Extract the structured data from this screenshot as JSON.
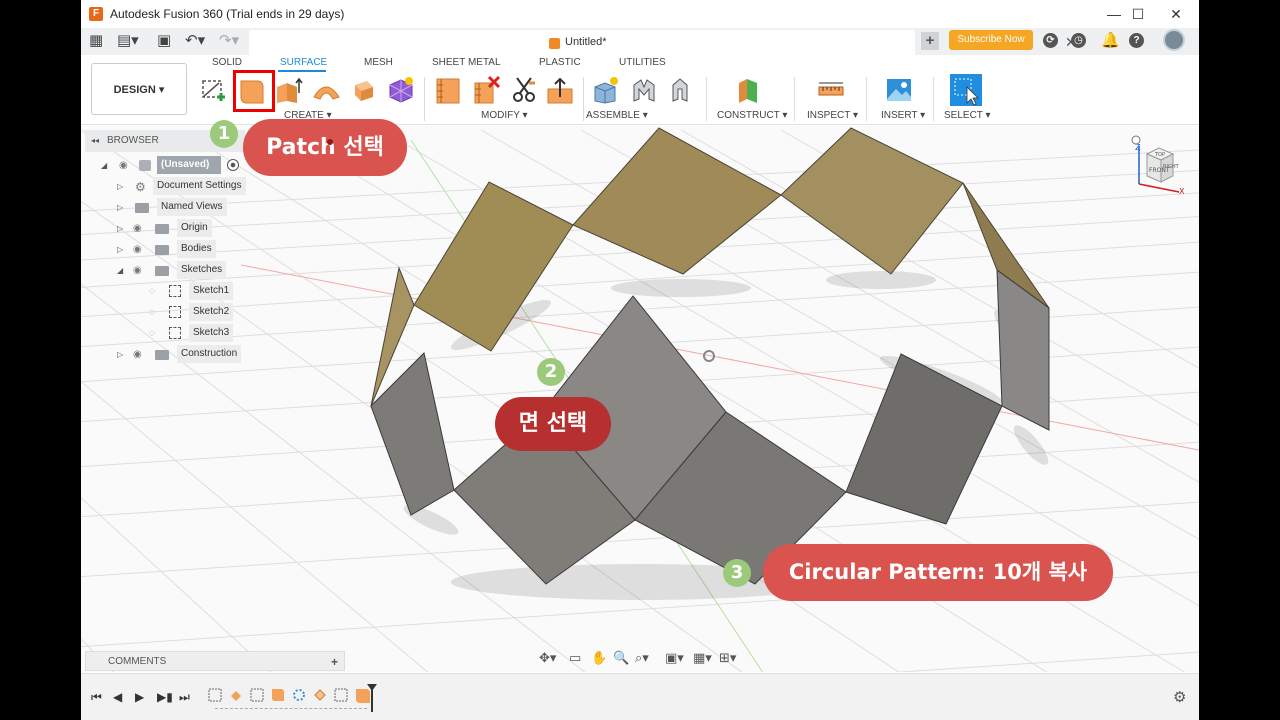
{
  "window": {
    "title": "Autodesk Fusion 360 (Trial ends in 29 days)",
    "logo_letter": "F",
    "minimize": "—",
    "maximize": "☐",
    "close": "✕"
  },
  "tabs": {
    "doc_title": "Untitled*",
    "close": "✕",
    "new": "+",
    "subscribe": "Subscribe Now"
  },
  "toolbar": {
    "workspace": "DESIGN ▾",
    "mode_tabs": [
      "SOLID",
      "SURFACE",
      "MESH",
      "SHEET METAL",
      "PLASTIC",
      "UTILITIES"
    ],
    "groups": {
      "create": "CREATE ▾",
      "modify": "MODIFY ▾",
      "assemble": "ASSEMBLE ▾",
      "construct": "CONSTRUCT ▾",
      "inspect": "INSPECT ▾",
      "insert": "INSERT ▾",
      "select": "SELECT ▾"
    }
  },
  "browser": {
    "header": "BROWSER",
    "root": "(Unsaved)",
    "items": [
      "Document Settings",
      "Named Views",
      "Origin",
      "Bodies",
      "Sketches",
      "Sketch1",
      "Sketch2",
      "Sketch3",
      "Construction"
    ]
  },
  "comments": {
    "label": "COMMENTS",
    "add": "+"
  },
  "viewcube": {
    "top": "TOP",
    "front": "FRONT",
    "right": "RIGHT",
    "z": "Z",
    "x": "X"
  },
  "callouts": [
    {
      "num": "1",
      "text": "Patch 선택"
    },
    {
      "num": "2",
      "text": "면 선택"
    },
    {
      "num": "3",
      "text": "Circular Pattern: 10개 복사"
    }
  ],
  "colors": {
    "accent": "#1d8ad9",
    "subscribe": "#f5a623",
    "callout_red": "#d9534f",
    "callout_dark_red": "#b5302e",
    "num_green": "#9cc97a",
    "patch_tan": "#a08c55",
    "patch_gray": "#7f7c77"
  }
}
